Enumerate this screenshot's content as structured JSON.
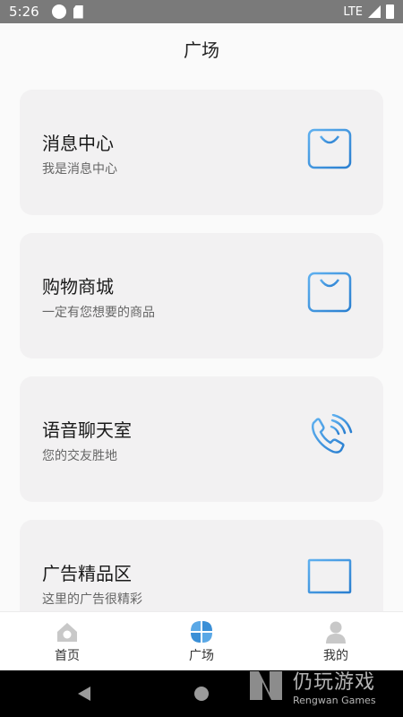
{
  "status_bar": {
    "time": "5:26",
    "network": "LTE"
  },
  "header": {
    "title": "广场"
  },
  "cards": [
    {
      "title": "消息中心",
      "subtitle": "我是消息中心",
      "icon": "bag-icon"
    },
    {
      "title": "购物商城",
      "subtitle": "一定有您想要的商品",
      "icon": "bag-icon"
    },
    {
      "title": "语音聊天室",
      "subtitle": "您的交友胜地",
      "icon": "phone-icon"
    },
    {
      "title": "广告精品区",
      "subtitle": "这里的广告很精彩",
      "icon": "board-icon"
    }
  ],
  "tabbar": {
    "home": "首页",
    "plaza": "广场",
    "mine": "我的"
  },
  "watermark": {
    "cn": "仍玩游戏",
    "en": "Rengwan Games"
  },
  "colors": {
    "accent": "#3a8fd6",
    "card_bg": "#f2f1f2",
    "tab_inactive": "#c8c8c8"
  }
}
